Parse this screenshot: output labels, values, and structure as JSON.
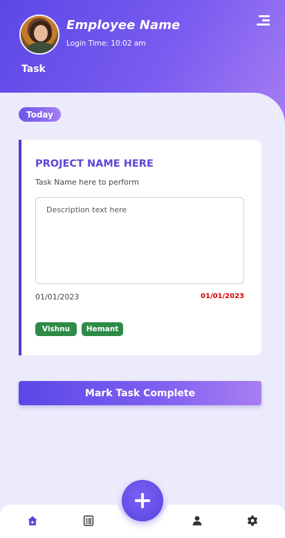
{
  "header": {
    "employee_name": "Employee Name",
    "login_time": "Login Time: 10:02 am",
    "page_title": "Task"
  },
  "filter": {
    "today_label": "Today"
  },
  "task_card": {
    "project_name": "PROJECT NAME HERE",
    "task_name": "Task Name here to perform",
    "description_placeholder": "Description text here",
    "start_date": "01/01/2023",
    "due_date": "01/01/2023",
    "assignees": [
      "Vishnu",
      "Hemant"
    ]
  },
  "actions": {
    "mark_complete_label": "Mark Task Complete"
  },
  "bottom_nav": {
    "items": [
      {
        "icon": "home-icon",
        "active": true
      },
      {
        "icon": "document-list-icon",
        "active": false
      },
      {
        "icon": "add-icon",
        "active": false
      },
      {
        "icon": "user-icon",
        "active": false
      },
      {
        "icon": "settings-icon",
        "active": false
      }
    ]
  },
  "colors": {
    "accent": "#5a46d9",
    "due_date": "#d10000",
    "tag": "#2e8b47",
    "background": "#ecebfb"
  }
}
